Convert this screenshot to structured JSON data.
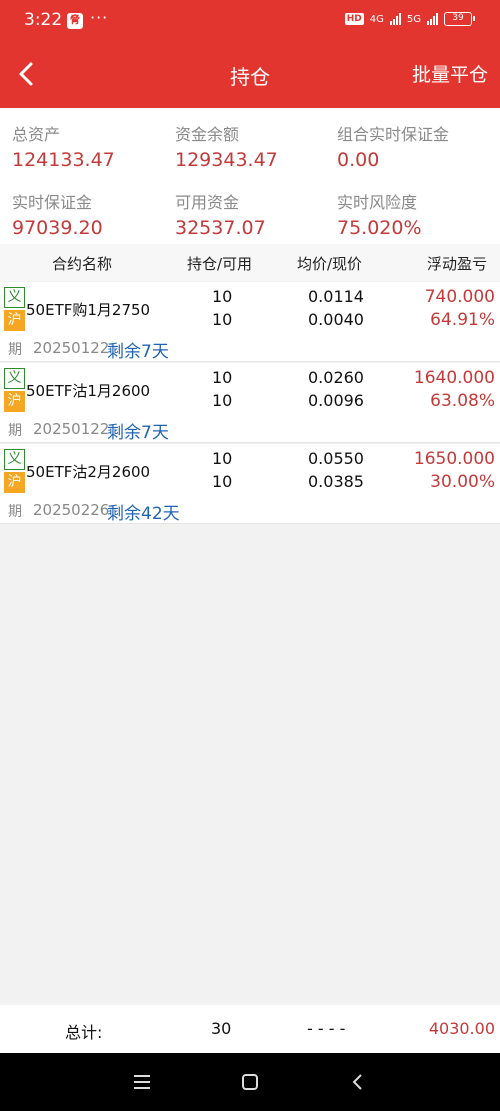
{
  "status_bar": {
    "time": "3:22",
    "app_badge": "脅",
    "dots": "···",
    "hd": "HD",
    "network1": "4G",
    "network2": "5G",
    "battery": "39"
  },
  "nav": {
    "title": "持仓",
    "action": "批量平仓",
    "back_icon": "chevron-left-icon"
  },
  "summary": [
    {
      "label": "总资产",
      "value": "124133.47"
    },
    {
      "label": "资金余额",
      "value": "129343.47"
    },
    {
      "label": "组合实时保证金",
      "value": "0.00"
    },
    {
      "label": "实时保证金",
      "value": "97039.20"
    },
    {
      "label": "可用资金",
      "value": "32537.07"
    },
    {
      "label": "实时风险度",
      "value": "75.020%"
    }
  ],
  "table": {
    "headers": [
      "合约名称",
      "持仓/可用",
      "均价/现价",
      "浮动盈亏"
    ],
    "rows": [
      {
        "badge_type": "义",
        "badge_market": "沪",
        "badge_kind": "期",
        "name": "50ETF购1月2750",
        "date": "20250122",
        "remaining": "剩余7天",
        "position": "10",
        "available": "10",
        "avg_price": "0.0114",
        "cur_price": "0.0040",
        "pl": "740.000",
        "pl_pct": "64.91%"
      },
      {
        "badge_type": "义",
        "badge_market": "沪",
        "badge_kind": "期",
        "name": "50ETF沽1月2600",
        "date": "20250122",
        "remaining": "剩余7天",
        "position": "10",
        "available": "10",
        "avg_price": "0.0260",
        "cur_price": "0.0096",
        "pl": "1640.000",
        "pl_pct": "63.08%"
      },
      {
        "badge_type": "义",
        "badge_market": "沪",
        "badge_kind": "期",
        "name": "50ETF沽2月2600",
        "date": "20250226",
        "remaining": "剩余42天",
        "position": "10",
        "available": "10",
        "avg_price": "0.0550",
        "cur_price": "0.0385",
        "pl": "1650.000",
        "pl_pct": "30.00%"
      }
    ]
  },
  "footer": {
    "label": "总计:",
    "total_qty": "30",
    "price_placeholder": "- - - -",
    "total_pl": "4030.00"
  },
  "system_nav": {
    "menu_icon": "menu-icon",
    "home_icon": "home-icon",
    "back_icon": "back-icon"
  },
  "colors": {
    "header": "#e3352f",
    "value_red": "#c43a3a",
    "remain_blue": "#1f63b5",
    "badge_orange": "#f5a623",
    "badge_green": "#2e8b2e"
  }
}
